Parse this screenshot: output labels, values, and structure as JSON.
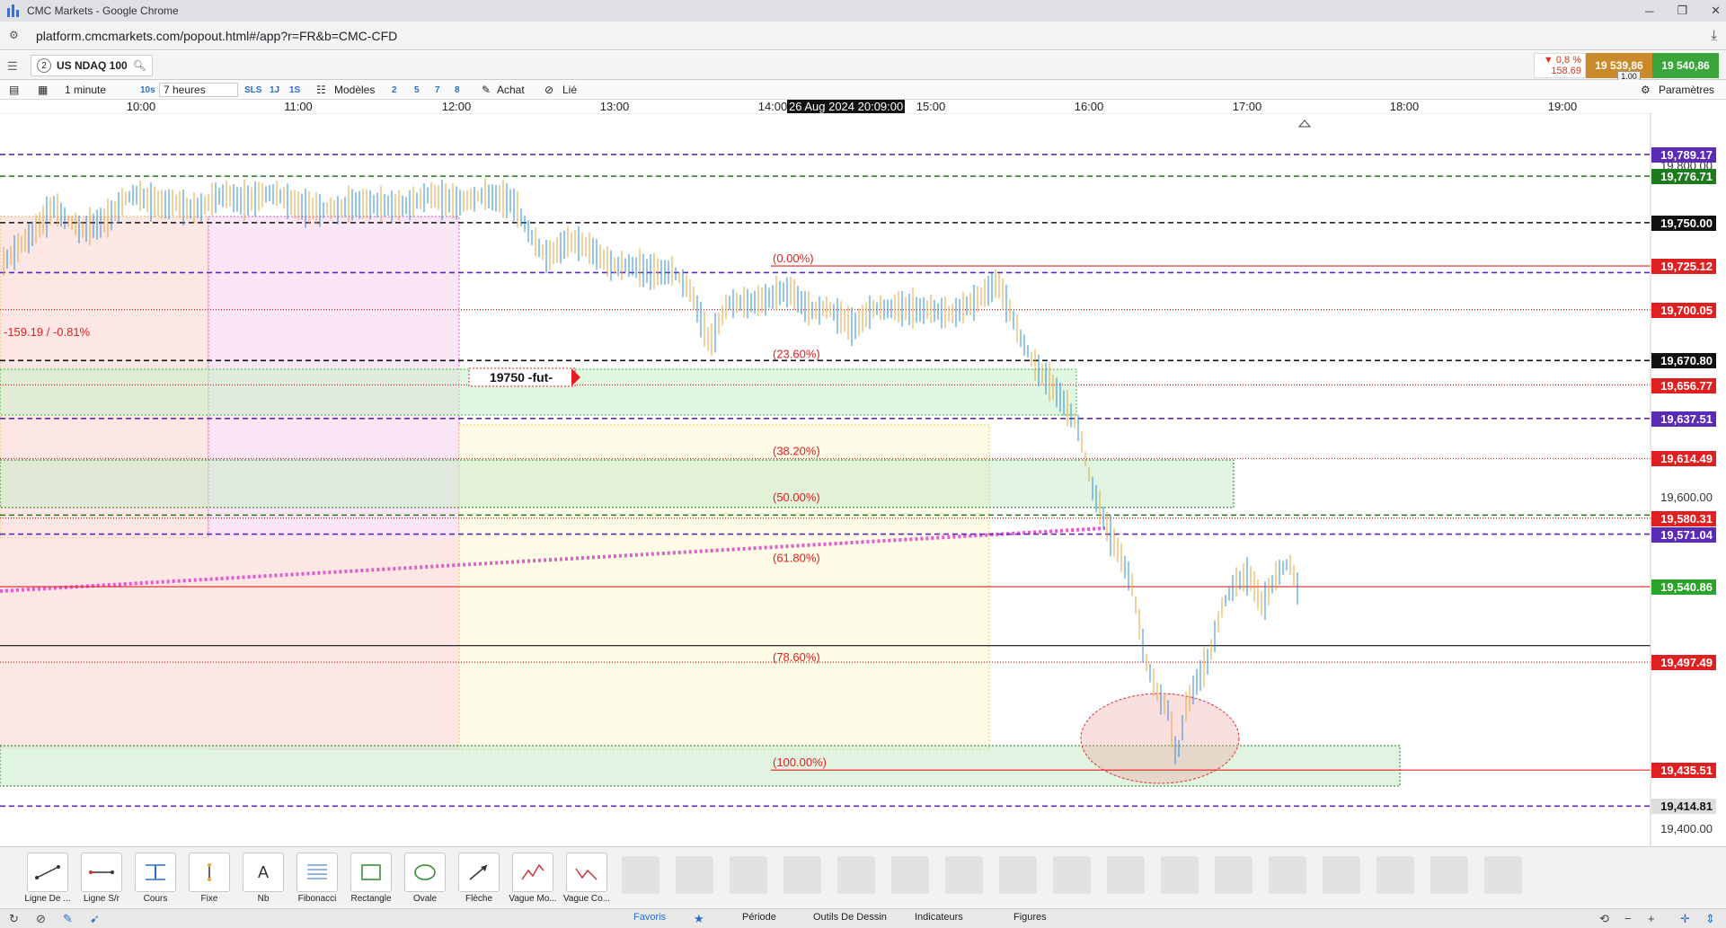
{
  "window": {
    "title": "CMC Markets - Google Chrome"
  },
  "address": {
    "url": "platform.cmcmarkets.com/popout.html#/app?r=FR&b=CMC-CFD"
  },
  "instrument": {
    "tab_number": "2",
    "name": "US NDAQ 100"
  },
  "quote": {
    "change_pct": "▼ 0,8 %",
    "change_pts": "158.69",
    "sell": "19 539,86",
    "buy": "19 540,86",
    "spread": "1.00"
  },
  "toolbar": {
    "interval": "1 minute",
    "interval_short": "10s",
    "range": "7 heures",
    "sls": "SLS",
    "one_day": "1J",
    "one_s": "1S",
    "models": "Modèles",
    "n2": "2",
    "n5": "5",
    "n7": "7",
    "n8": "8",
    "buy": "Achat",
    "linked": "Lié",
    "settings": "Paramètres"
  },
  "time_axis": {
    "labels": [
      "10:00",
      "11:00",
      "12:00",
      "13:00",
      "14:00",
      "15:00",
      "16:00",
      "17:00",
      "18:00",
      "19:00"
    ],
    "cursor": "26 Aug 2024 20:09:00"
  },
  "price_axis": {
    "plain": [
      "19,800.00",
      "19,600.00",
      "19,400.00"
    ],
    "labels": [
      {
        "text": "19,789.17",
        "color": "#5b2bb5"
      },
      {
        "text": "19,776.71",
        "color": "#1d7a1d"
      },
      {
        "text": "19,750.00",
        "color": "#111111"
      },
      {
        "text": "19,725.12",
        "color": "#e02020"
      },
      {
        "text": "19,700.05",
        "color": "#e02020"
      },
      {
        "text": "19,670.80",
        "color": "#111111"
      },
      {
        "text": "19,656.77",
        "color": "#e02020"
      },
      {
        "text": "19,637.51",
        "color": "#5b2bb5"
      },
      {
        "text": "19,614.49",
        "color": "#e02020"
      },
      {
        "text": "19,580.31",
        "color": "#e02020"
      },
      {
        "text": "19,571.04",
        "color": "#5b2bb5"
      },
      {
        "text": "19,540.86",
        "color": "#2aa52a"
      },
      {
        "text": "19,497.49",
        "color": "#e02020"
      },
      {
        "text": "19,435.51",
        "color": "#e02020"
      },
      {
        "text": "19,414.81",
        "color": "#555555"
      }
    ]
  },
  "annotations": {
    "change_text": "-159.19 / -0.81%",
    "fut_label": "19750  -fut-",
    "fib": [
      "(0.00%)",
      "(23.60%)",
      "(38.20%)",
      "(50.00%)",
      "(61.80%)",
      "(78.60%)",
      "(100.00%)"
    ]
  },
  "colors": {
    "accent_sell": "#c98a2a",
    "accent_buy": "#3aa53a",
    "candle": "#e8a23a",
    "candle_up": "#2a8bd8"
  },
  "tools": [
    "Ligne De ...",
    "Ligne S/r",
    "Cours",
    "Fixe",
    "Nb",
    "Fibonacci",
    "Rectangle",
    "Ovale",
    "Flèche",
    "Vague Mo...",
    "Vague Co..."
  ],
  "status_tabs": [
    "Favoris",
    "Période",
    "Outils De Dessin",
    "Indicateurs",
    "Figures"
  ]
}
